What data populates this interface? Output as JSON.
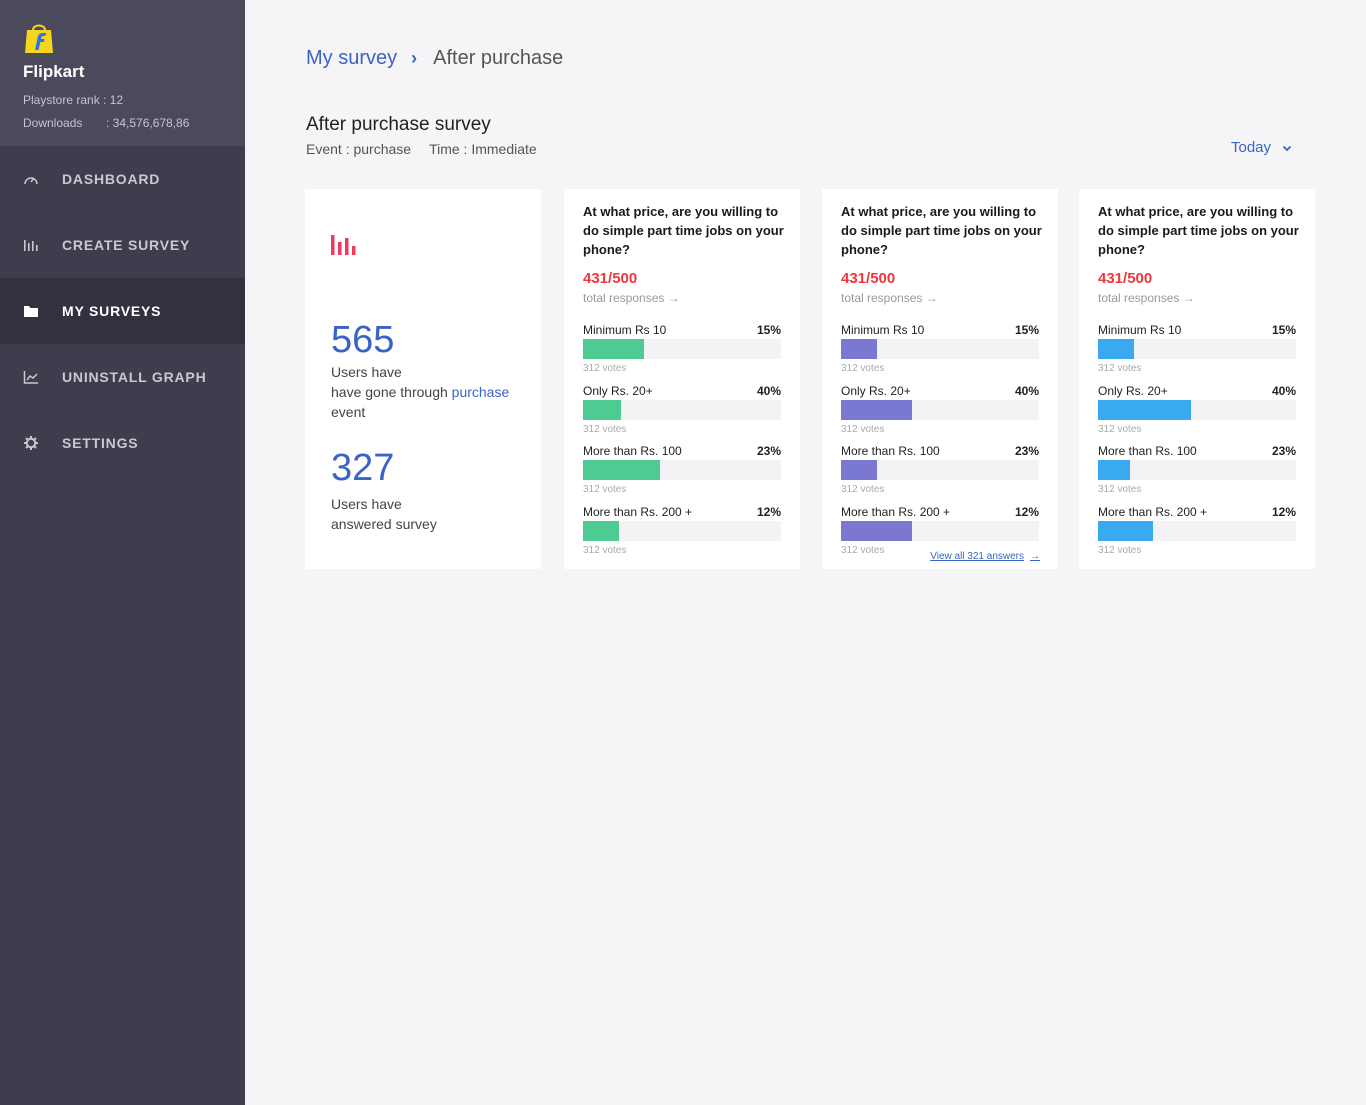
{
  "brand": {
    "name": "Flipkart",
    "rank_label": "Playstore rank : 12",
    "downloads_key": "Downloads",
    "downloads_value": ": 34,576,678,86"
  },
  "nav": [
    {
      "label": "DASHBOARD",
      "icon": "speedometer-icon"
    },
    {
      "label": "CREATE SURVEY",
      "icon": "bar-chart-icon"
    },
    {
      "label": "MY SURVEYS",
      "icon": "folder-icon",
      "active": true
    },
    {
      "label": "UNINSTALL GRAPH",
      "icon": "line-graph-icon"
    },
    {
      "label": "SETTINGS",
      "icon": "gear-icon"
    }
  ],
  "breadcrumb": {
    "parent": "My survey",
    "separator": "›",
    "current": "After purchase"
  },
  "survey": {
    "title": "After purchase survey",
    "event": "Event : purchase",
    "time": "Time : Immediate",
    "filter": "Today"
  },
  "stats": {
    "users_event": "565",
    "users_event_text_1": "Users have",
    "users_event_text_2": "have gone through",
    "users_event_link": "purchase",
    "users_event_text_3": "event",
    "users_answered": "327",
    "users_answered_text_1": "Users have",
    "users_answered_text_2": "answered survey"
  },
  "colors": {
    "accent": "#3a63c8",
    "red": "#f0383b",
    "green": "#4ecb93",
    "purple": "#7b78d1",
    "blue": "#39a9f0"
  },
  "questions": [
    {
      "title": "At what price, are you willing to do simple part time jobs on your phone?",
      "count": "431/500",
      "total_label": "total responses →",
      "color": "#4ecb93",
      "options": [
        {
          "label": "Minimum Rs 10",
          "pct": "15%",
          "fill": 0.31,
          "votes": "312 votes"
        },
        {
          "label": "Only Rs. 20+",
          "pct": "40%",
          "fill": 0.19,
          "votes": "312 votes"
        },
        {
          "label": "More than Rs. 100",
          "pct": "23%",
          "fill": 0.39,
          "votes": "312 votes"
        },
        {
          "label": "More than Rs. 200 +",
          "pct": "12%",
          "fill": 0.18,
          "votes": "312 votes"
        }
      ]
    },
    {
      "title": "At what price, are you willing to do simple part time jobs on your phone?",
      "count": "431/500",
      "total_label": "total responses →",
      "color": "#7b78d1",
      "view_all": "View all 321 answers",
      "options": [
        {
          "label": "Minimum Rs 10",
          "pct": "15%",
          "fill": 0.18,
          "votes": "312 votes"
        },
        {
          "label": "Only Rs. 20+",
          "pct": "40%",
          "fill": 0.36,
          "votes": "312 votes"
        },
        {
          "label": "More than Rs. 100",
          "pct": "23%",
          "fill": 0.18,
          "votes": "312 votes"
        },
        {
          "label": "More than Rs. 200 +",
          "pct": "12%",
          "fill": 0.36,
          "votes": "312 votes"
        }
      ]
    },
    {
      "title": "At what price, are you willing to do simple part time jobs on your phone?",
      "count": "431/500",
      "total_label": "total responses →",
      "color": "#39a9f0",
      "options": [
        {
          "label": "Minimum Rs 10",
          "pct": "15%",
          "fill": 0.18,
          "votes": "312 votes"
        },
        {
          "label": "Only Rs. 20+",
          "pct": "40%",
          "fill": 0.47,
          "votes": "312 votes"
        },
        {
          "label": "More than Rs. 100",
          "pct": "23%",
          "fill": 0.16,
          "votes": "312 votes"
        },
        {
          "label": "More than Rs. 200 +",
          "pct": "12%",
          "fill": 0.28,
          "votes": "312 votes"
        }
      ]
    }
  ]
}
